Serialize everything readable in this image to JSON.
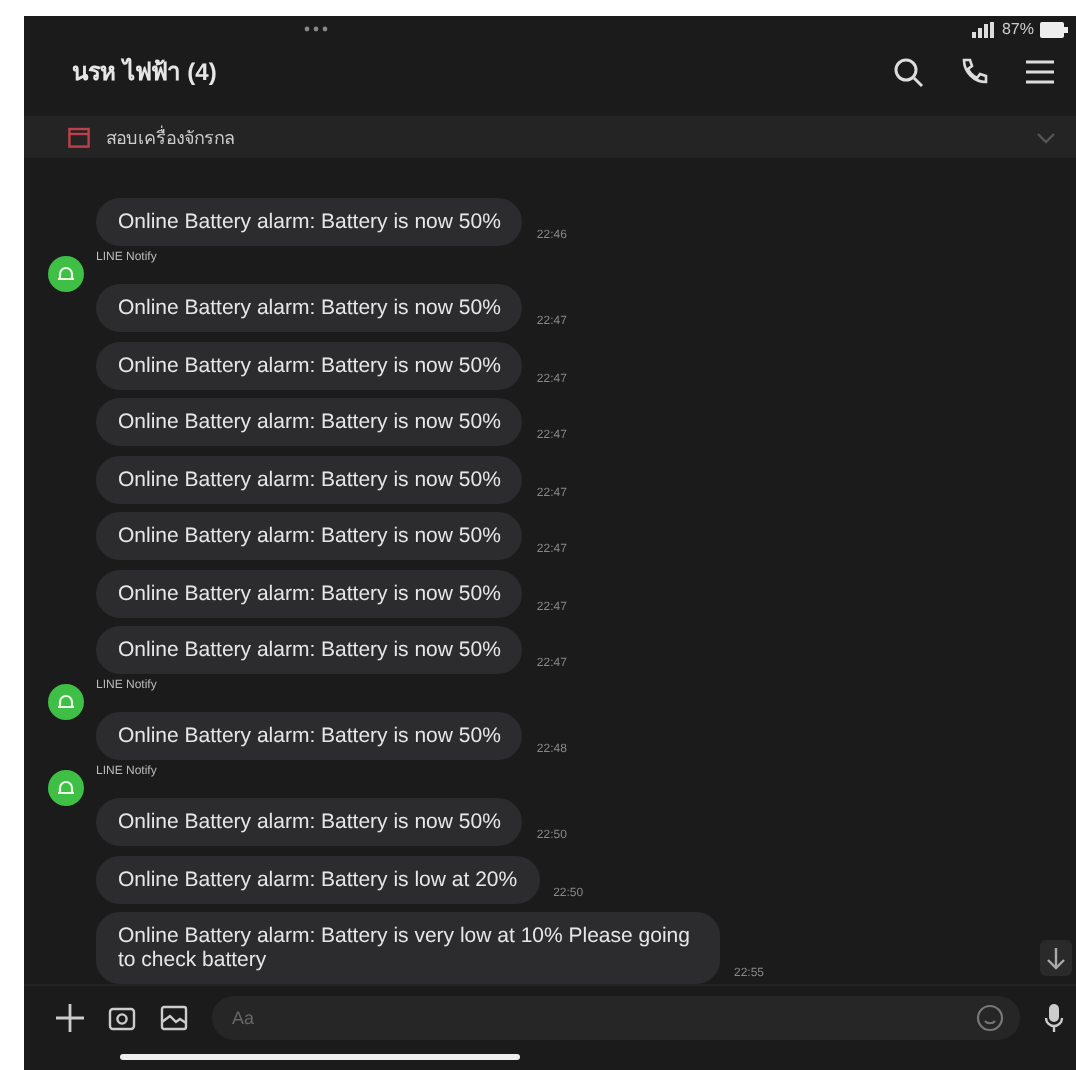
{
  "status_bar": {
    "battery": "87%"
  },
  "header": {
    "title": "นรห ไฟฟ้า (4)"
  },
  "pinned": {
    "text": "สอบเครื่องจักรกล"
  },
  "messages": [
    {
      "kind": "bubble",
      "text": "Online Battery alarm: Battery is now 50%",
      "time": "22:46"
    },
    {
      "kind": "sender",
      "name": "LINE Notify"
    },
    {
      "kind": "bubble",
      "text": "Online Battery alarm: Battery is now 50%",
      "time": "22:47"
    },
    {
      "kind": "bubble",
      "text": "Online Battery alarm: Battery is now 50%",
      "time": "22:47"
    },
    {
      "kind": "bubble",
      "text": "Online Battery alarm: Battery is now 50%",
      "time": "22:47"
    },
    {
      "kind": "bubble",
      "text": "Online Battery alarm: Battery is now 50%",
      "time": "22:47"
    },
    {
      "kind": "bubble",
      "text": "Online Battery alarm: Battery is now 50%",
      "time": "22:47"
    },
    {
      "kind": "bubble",
      "text": "Online Battery alarm: Battery is now 50%",
      "time": "22:47"
    },
    {
      "kind": "bubble",
      "text": "Online Battery alarm: Battery is now 50%",
      "time": "22:47"
    },
    {
      "kind": "sender",
      "name": "LINE Notify"
    },
    {
      "kind": "bubble",
      "text": "Online Battery alarm: Battery is now 50%",
      "time": "22:48"
    },
    {
      "kind": "sender",
      "name": "LINE Notify"
    },
    {
      "kind": "bubble",
      "text": "Online Battery alarm: Battery is now 50%",
      "time": "22:50"
    },
    {
      "kind": "bubble",
      "text": "Online Battery alarm: Battery is low at 20%",
      "time": "22:50"
    },
    {
      "kind": "bubble",
      "text": "Online Battery alarm: Battery is very low at 10% Please going to check battery",
      "time": "22:55"
    }
  ],
  "composer": {
    "placeholder": "Aa"
  }
}
